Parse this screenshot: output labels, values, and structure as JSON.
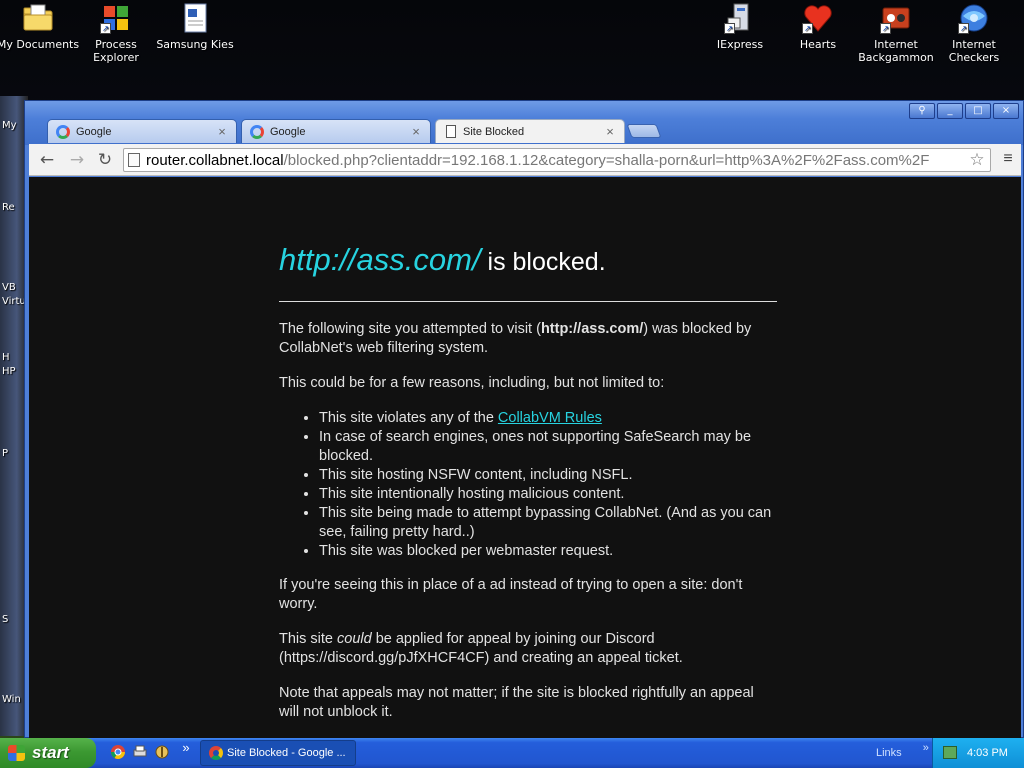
{
  "desktop": {
    "icons_left": [
      {
        "label": "My Documents",
        "icon": "folder-documents-icon",
        "shortcut": false
      },
      {
        "label": "Process Explorer",
        "icon": "process-explorer-icon",
        "shortcut": true
      },
      {
        "label": "Samsung Kies",
        "icon": "document-icon",
        "shortcut": false
      }
    ],
    "icons_right": [
      {
        "label": "IExpress",
        "icon": "iexpress-icon",
        "shortcut": true
      },
      {
        "label": "Hearts",
        "icon": "hearts-icon",
        "shortcut": true
      },
      {
        "label": "Internet Backgammon",
        "icon": "backgammon-icon",
        "shortcut": true
      },
      {
        "label": "Internet Checkers",
        "icon": "checkers-icon",
        "shortcut": true
      }
    ],
    "partial_labels": [
      "My",
      "Re",
      "VB",
      "Virtu",
      "H",
      "HP",
      "P",
      "S",
      "Win"
    ]
  },
  "browser": {
    "tabs": [
      {
        "label": "Google",
        "icon": "google-favicon",
        "active": false
      },
      {
        "label": "Google",
        "icon": "google-favicon",
        "active": false
      },
      {
        "label": "Site Blocked",
        "icon": "page-icon",
        "active": true
      }
    ],
    "close_glyph": "×",
    "window_controls": {
      "profile": "⚲",
      "minimize": "_",
      "maximize": "□",
      "close": "×"
    },
    "omnibox": {
      "host": "router.collabnet.local",
      "path": "/blocked.php?clientaddr=192.168.1.12&category=shalla-porn&url=http%3A%2F%2Fass.com%2F"
    },
    "nav": {
      "back": "←",
      "forward": "→",
      "reload": "↻",
      "star": "☆",
      "menu": "≡"
    }
  },
  "blocked_page": {
    "blocked_url": "http://ass.com/",
    "headline_suffix": " is blocked.",
    "intro_prefix": "The following site you attempted to visit (",
    "intro_url": "http://ass.com/",
    "intro_suffix": ") was blocked by CollabNet's web filtering system.",
    "reasons_intro": "This could be for a few reasons, including, but not limited to:",
    "reason_1_prefix": "This site violates any of the ",
    "reason_1_link": "CollabVM Rules",
    "reasons": [
      "In case of search engines, ones not supporting SafeSearch may be blocked.",
      "This site hosting NSFW content, including NSFL.",
      "This site intentionally hosting malicious content.",
      "This site being made to attempt bypassing CollabNet. (And as you can see, failing pretty hard..)",
      "This site was blocked per webmaster request."
    ],
    "ad_note": "If you're seeing this in place of a ad instead of trying to open a site: don't worry.",
    "appeal_prefix": "This site ",
    "appeal_emphasis": "could",
    "appeal_suffix": " be applied for appeal by joining our Discord (https://discord.gg/pJfXHCF4CF) and creating an appeal ticket.",
    "final_note": "Note that appeals may not matter; if the site is blocked rightfully an appeal will not unblock it."
  },
  "taskbar": {
    "start_label": "start",
    "quick_launch": [
      "chrome-icon",
      "printer-icon",
      "tool-icon"
    ],
    "overflow": "»",
    "task_button_label": "Site Blocked - Google ...",
    "links_label": "Links",
    "links_overflow": "»",
    "clock": "4:03 PM"
  },
  "colors": {
    "link_cyan": "#27d3e0",
    "page_bg": "#111111",
    "xp_blue": "#245edb",
    "start_green": "#3c9932"
  }
}
